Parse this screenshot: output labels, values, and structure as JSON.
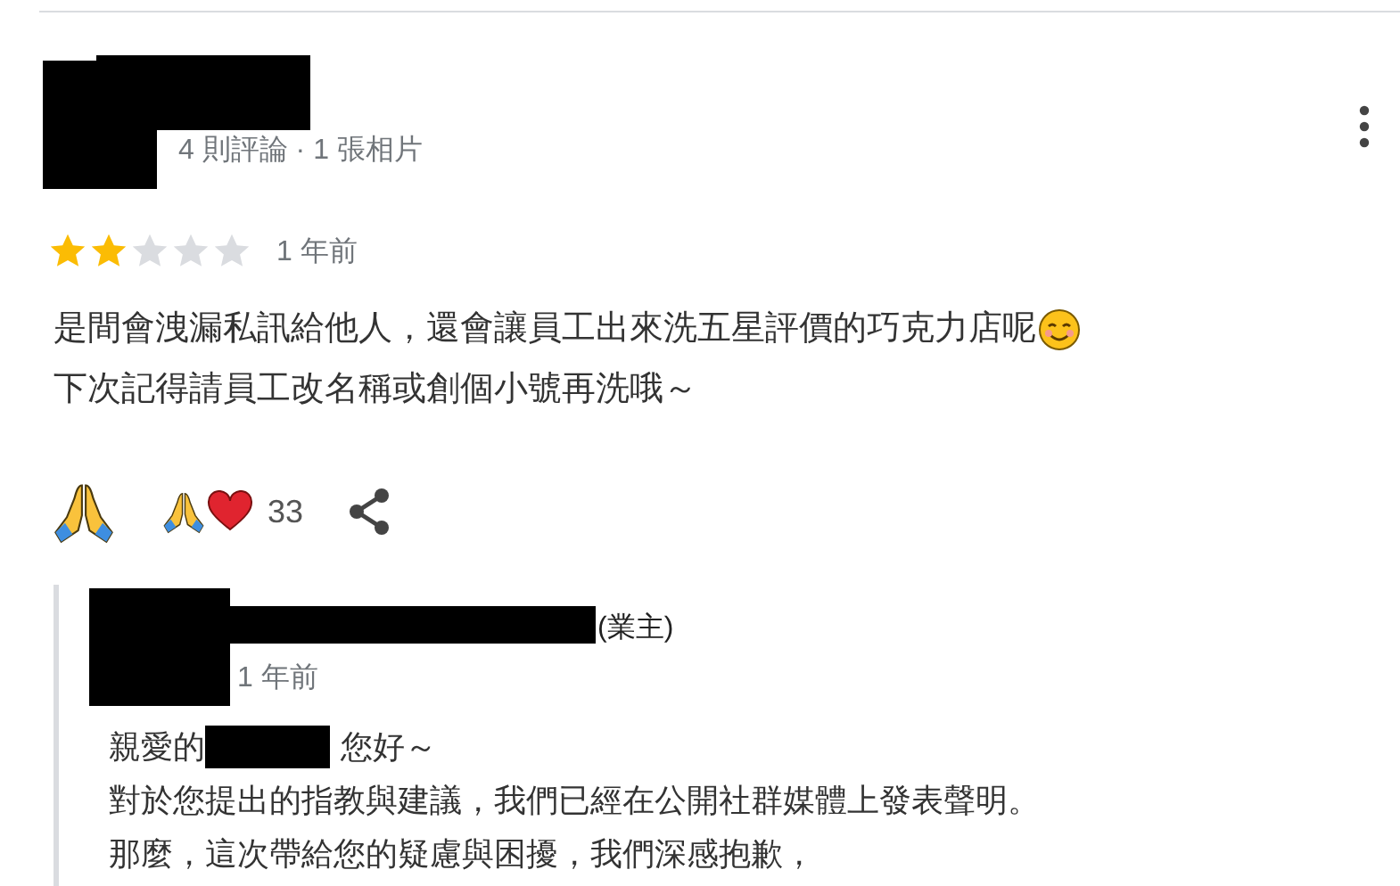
{
  "review": {
    "meta": "4 則評論 · 1 張相片",
    "stars": 2,
    "time": "1 年前",
    "body": [
      "是間會洩漏私訊給他人，還會讓員工出來洗五星評價的巧克力店呢",
      "下次記得請員工改名稱或創個小號再洗哦～"
    ],
    "reaction_count": "33"
  },
  "reply": {
    "owner_tag": "(業主)",
    "time": "1 年前",
    "greeting": [
      "親愛的",
      "您好～"
    ],
    "body": [
      "對於您提出的指教與建議，我們已經在公開社群媒體上發表聲明。",
      "那麼，這次帶給您的疑慮與困擾，我們深感抱歉，"
    ]
  }
}
